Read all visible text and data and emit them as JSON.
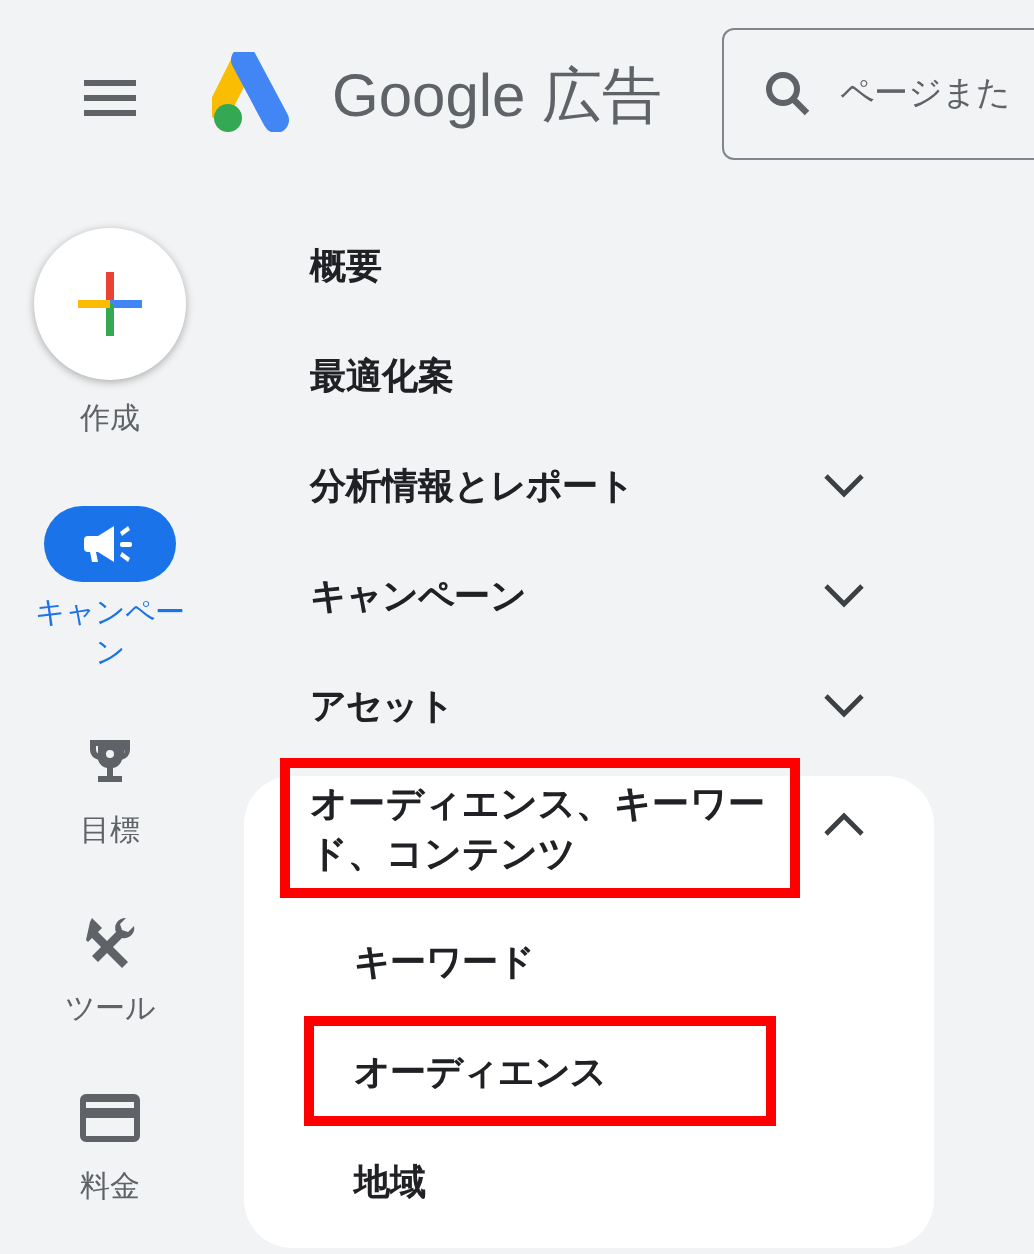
{
  "header": {
    "logo_text": "Google 広告",
    "search": {
      "placeholder": "ページまた"
    }
  },
  "rail": [
    {
      "kind": "create",
      "label": "作成",
      "selected": false
    },
    {
      "kind": "campaigns",
      "label": "キャンペーン",
      "selected": true
    },
    {
      "kind": "goals",
      "label": "目標",
      "selected": false
    },
    {
      "kind": "tools",
      "label": "ツール",
      "selected": false
    },
    {
      "kind": "billing",
      "label": "料金",
      "selected": false
    }
  ],
  "menu": [
    {
      "kind": "link",
      "label": "概要",
      "highlighted": false
    },
    {
      "kind": "link",
      "label": "最適化案",
      "highlighted": false
    },
    {
      "kind": "group",
      "label": "分析情報とレポート",
      "expanded": false,
      "highlighted": false
    },
    {
      "kind": "group",
      "label": "キャンペーン",
      "expanded": false,
      "highlighted": false
    },
    {
      "kind": "group",
      "label": "アセット",
      "expanded": false,
      "highlighted": false
    },
    {
      "kind": "group",
      "label": "オーディエンス、キーワード、コンテンツ",
      "expanded": true,
      "highlighted": true,
      "children": [
        {
          "label": "キーワード",
          "highlighted": false
        },
        {
          "label": "オーディエンス",
          "highlighted": true
        },
        {
          "label": "地域",
          "highlighted": false
        }
      ]
    }
  ]
}
